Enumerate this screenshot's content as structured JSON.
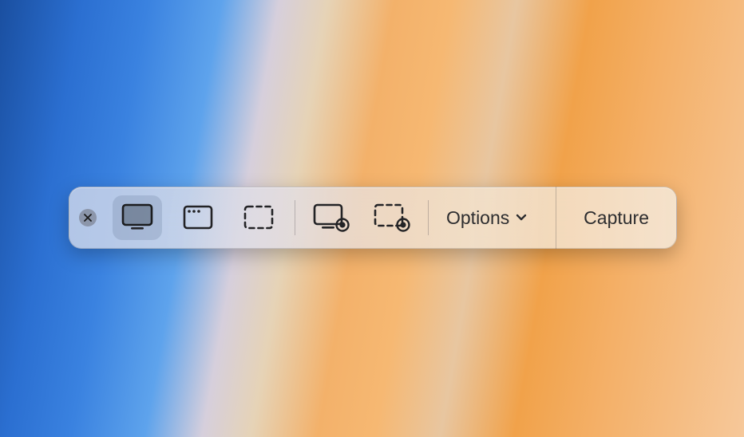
{
  "toolbar": {
    "close_label": "Close",
    "modes": {
      "capture_entire_screen": "Capture Entire Screen",
      "capture_selected_window": "Capture Selected Window",
      "capture_selected_portion": "Capture Selected Portion",
      "record_entire_screen": "Record Entire Screen",
      "record_selected_portion": "Record Selected Portion"
    },
    "options_label": "Options",
    "primary_action_label": "Capture",
    "selected_mode": "capture_entire_screen"
  }
}
